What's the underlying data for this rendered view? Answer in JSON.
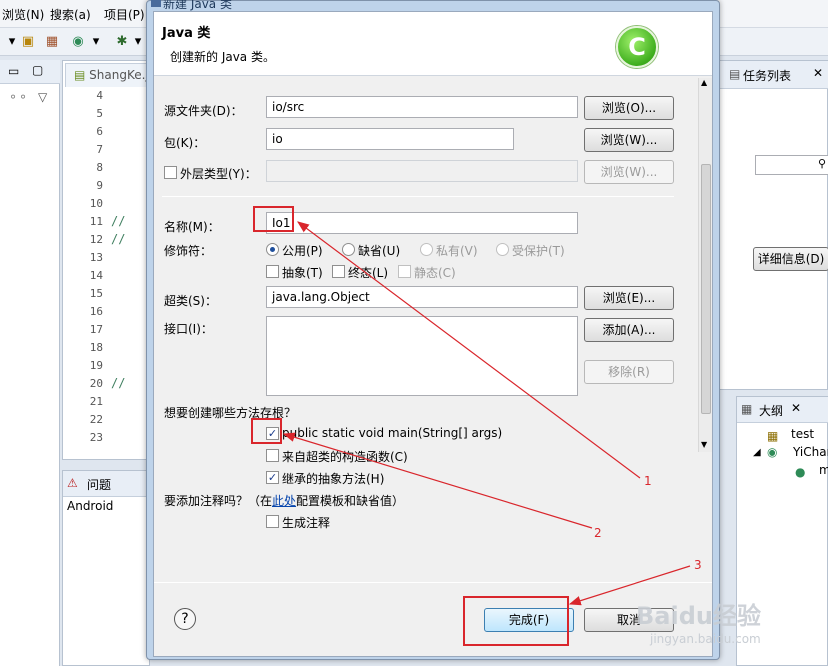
{
  "menubar": {
    "items": [
      "浏览(N)",
      "搜索(a)",
      "项目(P)"
    ]
  },
  "editor": {
    "tab": "ShangKe.j",
    "line_numbers": [
      "4",
      "5",
      "6",
      "7",
      "8",
      "9",
      "10",
      "11",
      "12",
      "13",
      "14",
      "15",
      "16",
      "17",
      "18",
      "19",
      "20",
      "21",
      "22",
      "23"
    ],
    "comments": [
      "//",
      "//",
      "//"
    ]
  },
  "problems": {
    "tab": "问题",
    "row": "Android"
  },
  "tasks": {
    "title": "任务列表",
    "detail_button": "详细信息(D)"
  },
  "outline": {
    "title": "大纲",
    "items": [
      "test",
      "YiChar",
      "m"
    ]
  },
  "dialog": {
    "window_title": "新建 Java 类",
    "header_title": "Java 类",
    "header_subtitle": "创建新的 Java 类。",
    "source_folder": {
      "label": "源文件夹(D)：",
      "value": "io/src",
      "browse": "浏览(O)..."
    },
    "package": {
      "label": "包(K)：",
      "value": "io",
      "browse": "浏览(W)..."
    },
    "enclosing": {
      "label": "外层类型(Y)：",
      "value": "",
      "browse": "浏览(W)..."
    },
    "name": {
      "label": "名称(M)：",
      "value": "Io1"
    },
    "modifiers": {
      "label": "修饰符：",
      "public": "公用(P)",
      "default": "缺省(U)",
      "private": "私有(V)",
      "protected": "受保护(T)",
      "abstract": "抽象(T)",
      "final": "终态(L)",
      "static": "静态(C)"
    },
    "superclass": {
      "label": "超类(S)：",
      "value": "java.lang.Object",
      "browse": "浏览(E)..."
    },
    "interfaces": {
      "label": "接口(I)：",
      "add": "添加(A)...",
      "remove": "移除(R)"
    },
    "stubs": {
      "question": "想要创建哪些方法存根？",
      "main": "public static void main(String[] args)",
      "ctor": "来自超类的构造函数(C)",
      "inherited": "继承的抽象方法(H)"
    },
    "comments": {
      "question_pre": "要添加注释吗？（在",
      "question_link": "此处",
      "question_post": "配置模板和缺省值）",
      "generate": "生成注释"
    },
    "help": "?",
    "finish": "完成(F)",
    "cancel": "取消"
  },
  "annotations": [
    "1",
    "2",
    "3"
  ],
  "watermark": {
    "text": "Baidu经验",
    "url": "jingyan.baidu.com"
  },
  "colors": {
    "annotation_red": "#d9262c",
    "class_icon_green": "#3fae1e",
    "link_blue": "#0645ad"
  }
}
